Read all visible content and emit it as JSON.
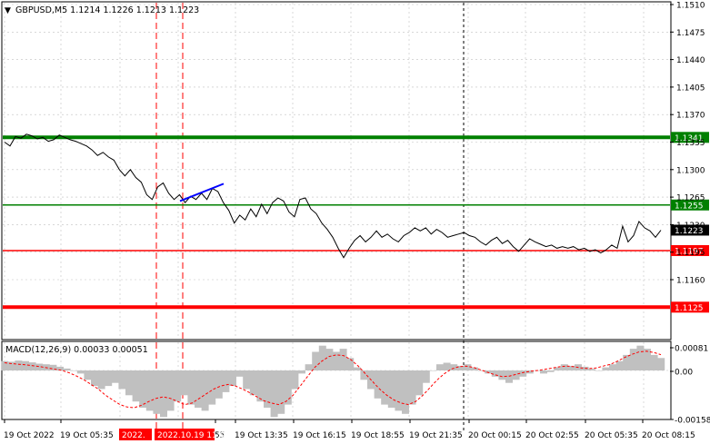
{
  "header": {
    "symbol_line": "GBPUSD,M5  1.1214 1.1226 1.1213 1.1223",
    "macd_line": "MACD(12,26,9) 0.00033 0.00051"
  },
  "colors": {
    "background": "#ffffff",
    "price_line": "#000000",
    "grid": "#c0c0c0",
    "support_level": "#ff0000",
    "resistance_level": "#008000",
    "trendline": "#0000ff",
    "current_price_label": "#000000",
    "histogram": "#c0c0c0",
    "signal_line": "#ff0000"
  },
  "price_axis": {
    "ticks": [
      "1.1510",
      "1.1475",
      "1.1440",
      "1.1405",
      "1.1370",
      "1.1335",
      "1.1300",
      "1.1265",
      "1.1230",
      "1.1195",
      "1.1160"
    ],
    "tick_values": [
      1.151,
      1.1475,
      1.144,
      1.1405,
      1.137,
      1.1335,
      1.13,
      1.1265,
      1.123,
      1.1195,
      1.116
    ]
  },
  "levels": [
    {
      "label": "1.1341",
      "value": 1.1341,
      "color": "#008000",
      "style": "thick"
    },
    {
      "label": "1.1255",
      "value": 1.1255,
      "color": "#008000",
      "style": "normal"
    },
    {
      "label": "1.1197",
      "value": 1.1197,
      "color": "#ff0000",
      "style": "normal"
    },
    {
      "label": "1.1125",
      "value": 1.1125,
      "color": "#ff0000",
      "style": "thick"
    }
  ],
  "current_price": {
    "label": "1.1223",
    "value": 1.1223
  },
  "macd_axis": {
    "ticks": [
      "0.00081",
      "0.00",
      "-0.00158"
    ],
    "tick_values": [
      0.00081,
      0.0,
      -0.00158
    ]
  },
  "time_axis": {
    "labels": [
      "19 Oct 2022",
      "19 Oct 05:35",
      "55",
      "19 Oct 13:35",
      "19 Oct 16:15",
      "19 Oct 18:55",
      "19 Oct 21:35",
      "20 Oct 00:15",
      "20 Oct 02:55",
      "20 Oct 05:35",
      "20 Oct 08:15"
    ],
    "highlight_left": "2022.",
    "highlight_right": "2022.10.19 11:05"
  },
  "chart_data": {
    "type": "line",
    "title": "GBPUSD,M5",
    "ohlc": {
      "open": 1.1214,
      "high": 1.1226,
      "low": 1.1213,
      "close": 1.1223
    },
    "ylim": [
      1.1125,
      1.1515
    ],
    "price_series": [
      1.1335,
      1.133,
      1.1342,
      1.134,
      1.1345,
      1.1343,
      1.1339,
      1.1341,
      1.1336,
      1.1338,
      1.1344,
      1.1341,
      1.1338,
      1.1336,
      1.1333,
      1.133,
      1.1325,
      1.1318,
      1.1322,
      1.1316,
      1.1312,
      1.13,
      1.1292,
      1.13,
      1.129,
      1.1284,
      1.1268,
      1.1262,
      1.1278,
      1.1283,
      1.127,
      1.1262,
      1.1268,
      1.1258,
      1.1266,
      1.1262,
      1.127,
      1.1262,
      1.1276,
      1.1272,
      1.1258,
      1.1248,
      1.1232,
      1.1242,
      1.1236,
      1.125,
      1.124,
      1.1256,
      1.1244,
      1.1258,
      1.1264,
      1.126,
      1.1246,
      1.124,
      1.1262,
      1.1264,
      1.125,
      1.1244,
      1.1232,
      1.1224,
      1.1214,
      1.12,
      1.1188,
      1.12,
      1.121,
      1.1216,
      1.1208,
      1.1214,
      1.1222,
      1.1214,
      1.1218,
      1.1212,
      1.1208,
      1.1216,
      1.122,
      1.1226,
      1.1222,
      1.1226,
      1.1218,
      1.1224,
      1.122,
      1.1214,
      1.1216,
      1.1218,
      1.122,
      1.1216,
      1.1214,
      1.1208,
      1.1204,
      1.121,
      1.1214,
      1.1206,
      1.121,
      1.1202,
      1.1196,
      1.1204,
      1.1212,
      1.1208,
      1.1205,
      1.1202,
      1.1204,
      1.12,
      1.1202,
      1.12,
      1.1202,
      1.1198,
      1.12,
      1.1196,
      1.1198,
      1.1194,
      1.1198,
      1.1204,
      1.12,
      1.1228,
      1.1208,
      1.1216,
      1.1234,
      1.1226,
      1.1222,
      1.1214,
      1.1223
    ],
    "trendline": {
      "start": 1.126,
      "end": 1.1282
    },
    "macd_histogram": [
      0.0003,
      0.00028,
      0.00032,
      0.0003,
      0.00026,
      0.00022,
      0.0002,
      0.00018,
      0.00012,
      6e-05,
      0.0,
      -0.0001,
      -0.0003,
      -0.0005,
      -0.0006,
      -0.0005,
      -0.0004,
      -0.0006,
      -0.0008,
      -0.001,
      -0.0012,
      -0.0013,
      -0.0014,
      -0.0015,
      -0.0013,
      -0.001,
      -0.0008,
      -0.0011,
      -0.0012,
      -0.0013,
      -0.0011,
      -0.0009,
      -0.0007,
      -0.0005,
      -0.0002,
      -0.0006,
      -0.0008,
      -0.001,
      -0.0012,
      -0.0015,
      -0.0014,
      -0.0011,
      -0.0006,
      -0.0001,
      0.0002,
      0.0006,
      0.0008,
      0.0007,
      0.0006,
      0.0007,
      0.0004,
      0.0001,
      -0.0003,
      -0.0006,
      -0.0009,
      -0.0011,
      -0.0012,
      -0.0013,
      -0.0014,
      -0.0011,
      -0.0008,
      -0.0004,
      0.0,
      0.0002,
      0.00025,
      0.0002,
      0.00015,
      0.0002,
      0.0001,
      0.0,
      -0.0001,
      -0.0002,
      -0.0003,
      -0.0004,
      -0.0003,
      -0.0002,
      -0.0001,
      0.0,
      -0.0001,
      -5e-05,
      0.0001,
      0.0002,
      0.00015,
      0.0002,
      0.00012,
      5e-05,
      0.0,
      0.0001,
      0.0002,
      0.0003,
      0.0005,
      0.0007,
      0.0008,
      0.0007,
      0.0005,
      0.0004
    ],
    "macd_signal": [
      0.00025,
      0.00022,
      0.0002,
      0.00018,
      0.00015,
      0.00012,
      8e-05,
      4e-05,
      0.0,
      -8e-05,
      -0.00018,
      -0.0003,
      -0.00045,
      -0.0006,
      -0.0008,
      -0.00095,
      -0.0011,
      -0.00118,
      -0.0012,
      -0.00112,
      -0.001,
      -0.0009,
      -0.00085,
      -0.0009,
      -0.001,
      -0.0011,
      -0.00105,
      -0.0009,
      -0.00075,
      -0.0006,
      -0.0005,
      -0.00045,
      -0.0005,
      -0.0006,
      -0.00072,
      -0.00085,
      -0.00098,
      -0.00105,
      -0.0011,
      -0.001,
      -0.0008,
      -0.0005,
      -0.0002,
      0.0001,
      0.0003,
      0.00045,
      0.0005,
      0.00048,
      0.00035,
      0.00015,
      -0.0001,
      -0.00035,
      -0.0006,
      -0.0008,
      -0.00095,
      -0.00105,
      -0.0011,
      -0.001,
      -0.0008,
      -0.00055,
      -0.0003,
      -0.0001,
      5e-05,
      0.00012,
      0.00014,
      0.0001,
      2e-05,
      -6e-05,
      -0.00014,
      -0.0002,
      -0.00018,
      -0.00012,
      -6e-05,
      -2e-05,
      0.0,
      4e-05,
      8e-05,
      0.00012,
      0.00014,
      0.00012,
      8e-05,
      6e-05,
      8e-05,
      0.00014,
      0.0002,
      0.0003,
      0.00042,
      0.00052,
      0.0006,
      0.00062,
      0.00058,
      0.00051
    ]
  }
}
